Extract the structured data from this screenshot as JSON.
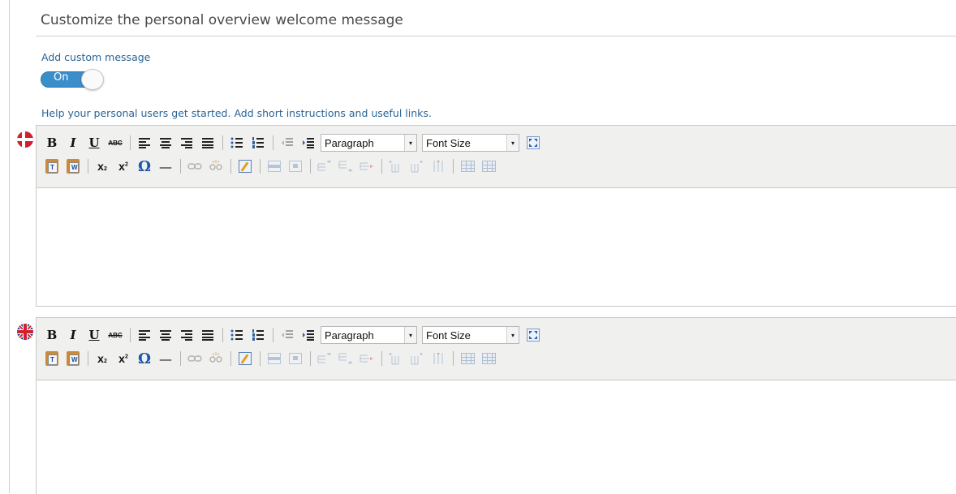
{
  "section": {
    "title": "Customize the personal overview welcome message",
    "toggle_label": "Add custom message",
    "toggle_state": "On",
    "help_text": "Help your personal users get started. Add short instructions and useful links."
  },
  "colors": {
    "accent": "#3a8ec9",
    "link_text": "#2a6496",
    "toolbar_bg": "#f0f0ee"
  },
  "editors": [
    {
      "flag": "denmark-flag-icon",
      "format_select": "Paragraph",
      "size_select": "Font Size",
      "content": ""
    },
    {
      "flag": "uk-flag-icon",
      "format_select": "Paragraph",
      "size_select": "Font Size",
      "content": ""
    }
  ],
  "toolbar": {
    "bold": "B",
    "italic": "I",
    "underline": "U",
    "strike": "ABC",
    "omega": "Ω",
    "hr": "—",
    "sub": "x",
    "sup": "x",
    "sub_mark": "2",
    "sup_mark": "2",
    "paste_text_letter": "T",
    "paste_word_letter": "W",
    "dropdown_arrow": "▾"
  }
}
